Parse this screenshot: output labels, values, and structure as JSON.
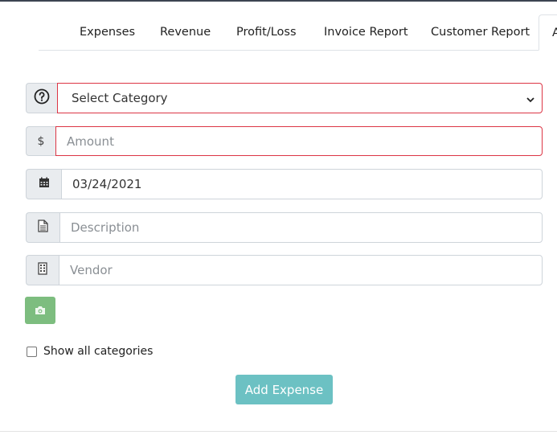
{
  "tabs": [
    {
      "label": "Expenses"
    },
    {
      "label": "Revenue"
    },
    {
      "label": "Profit/Loss"
    },
    {
      "label": "Invoice Report"
    },
    {
      "label": "Customer Report"
    },
    {
      "label": "A"
    }
  ],
  "form": {
    "category": {
      "icon": "question-circle-icon",
      "selected": "Select Category",
      "invalid": true
    },
    "amount": {
      "icon_text": "$",
      "placeholder": "Amount",
      "invalid": true
    },
    "date": {
      "icon": "calendar-icon",
      "value": "03/24/2021"
    },
    "description": {
      "icon": "file-icon",
      "placeholder": "Description"
    },
    "vendor": {
      "icon": "building-icon",
      "placeholder": "Vendor"
    },
    "camera_button": {
      "icon": "camera-icon"
    },
    "show_all_categories": {
      "label": "Show all categories",
      "checked": false
    },
    "submit_label": "Add Expense"
  },
  "colors": {
    "invalid_border": "#dc3545",
    "camera_button": "#7dbd7f",
    "submit_button": "#6cc1c3",
    "addon_bg": "#e9ecef"
  }
}
